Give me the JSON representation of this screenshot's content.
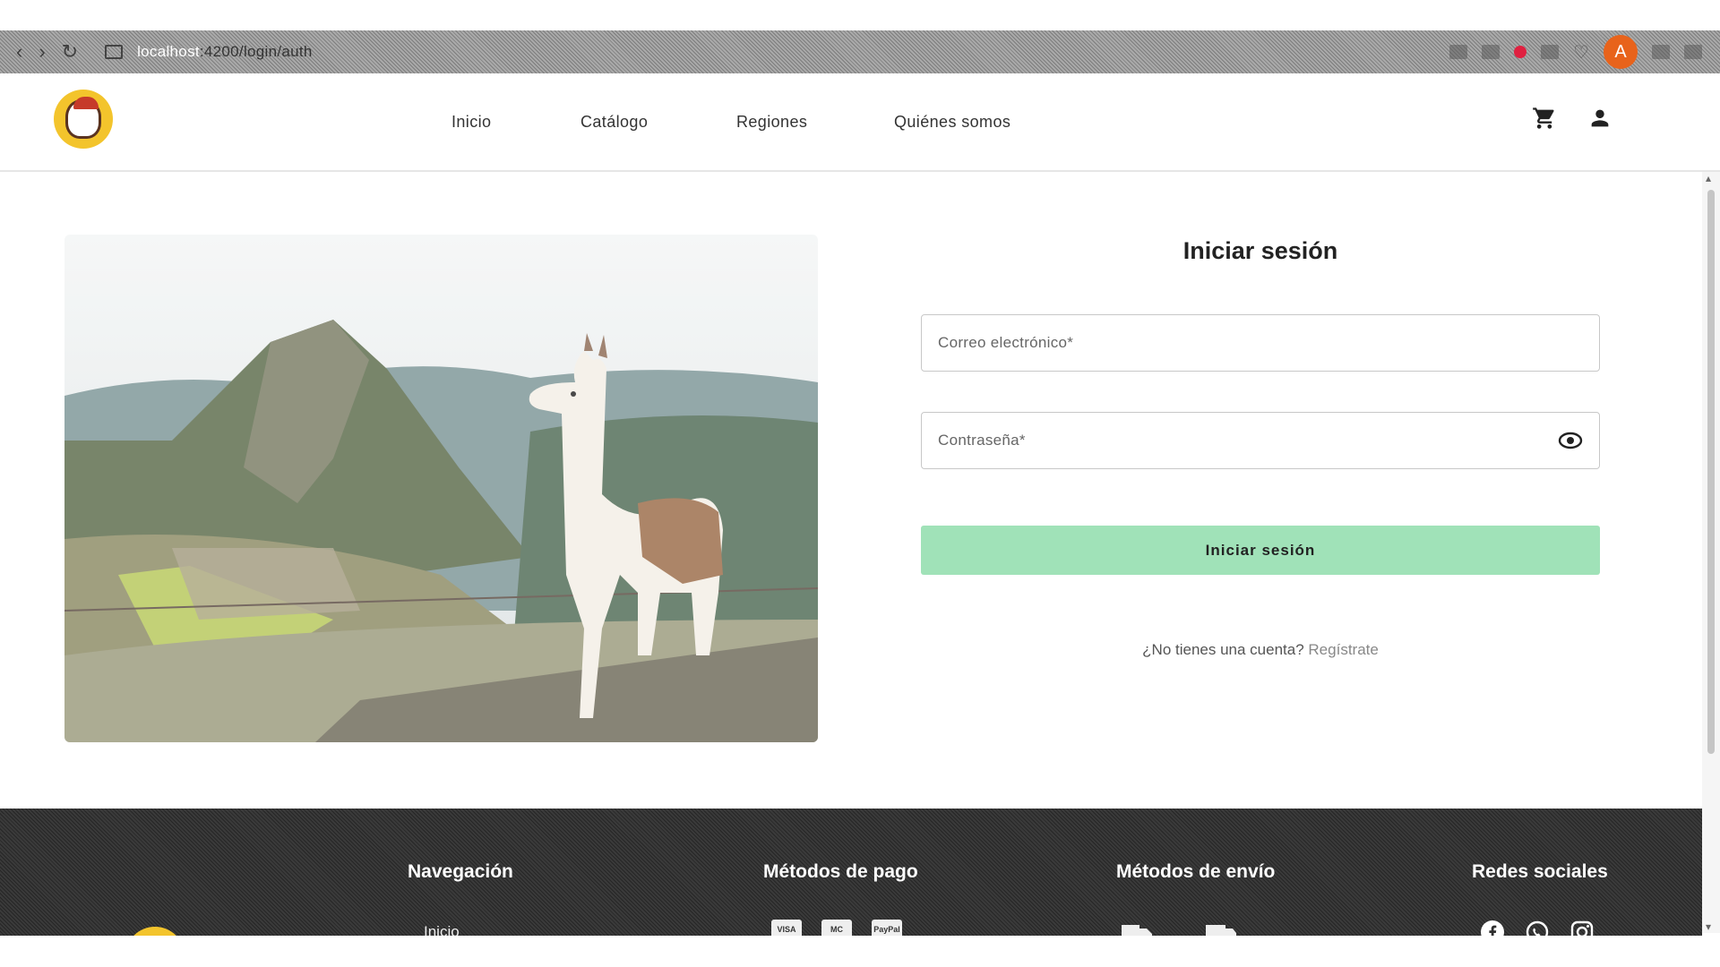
{
  "browser": {
    "address_host": "localhost",
    "address_path": ":4200/login/auth",
    "profile_initial": "A",
    "back_icon": "back-arrow-icon",
    "forward_icon": "forward-arrow-icon",
    "reload_icon": "reload-icon"
  },
  "header": {
    "nav": {
      "inicio": "Inicio",
      "catalogo": "Catálogo",
      "regiones": "Regiones",
      "quienes": "Quiénes somos"
    },
    "icons": [
      "cart-icon",
      "user-icon"
    ]
  },
  "login": {
    "title": "Iniciar sesión",
    "email_placeholder": "Correo electrónico*",
    "email_value": "",
    "password_placeholder": "Contraseña*",
    "password_value": "",
    "submit_label": "Iniciar sesión",
    "register_prompt": "¿No tienes una cuenta?",
    "register_link": "Regístrate"
  },
  "footer": {
    "nav_heading": "Navegación",
    "nav_first_link": "Inicio",
    "payment_heading": "Métodos de pago",
    "payment_methods": [
      "VISA",
      "MC",
      "PayPal"
    ],
    "shipping_heading": "Métodos de envío",
    "social_heading": "Redes sociales",
    "social_icons": [
      "facebook-icon",
      "whatsapp-icon",
      "instagram-icon"
    ]
  },
  "colors": {
    "submit_bg": "#a0e2b8",
    "footer_bg": "#2e2e2e",
    "logo_yellow": "#f3c42c",
    "avatar_orange": "#e8631b"
  }
}
